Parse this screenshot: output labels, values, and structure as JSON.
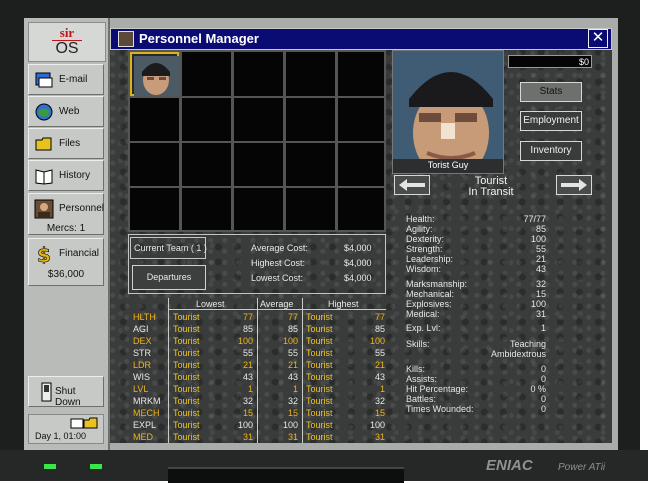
{
  "window": {
    "title": "Personnel Manager",
    "close": "✕"
  },
  "logo": {
    "top": "sir",
    "bottom": "OS"
  },
  "sidebar": {
    "email": "E-mail",
    "web": "Web",
    "files": "Files",
    "history": "History",
    "personnel": "Personnel",
    "mercs": "Mercs: 1",
    "financial": "Financial",
    "balance": "$36,000",
    "shutdown": "Shut Down",
    "datetime": "Day 1, 01:00"
  },
  "team": {
    "current": "Current Team ( 1 )",
    "departures": "Departures",
    "avg_label": "Average Cost:",
    "avg_value": "$4,000",
    "high_label": "Highest Cost:",
    "high_value": "$4,000",
    "low_label": "Lowest Cost:",
    "low_value": "$4,000"
  },
  "table": {
    "headers": [
      "Lowest",
      "Average",
      "Highest"
    ],
    "rows": [
      {
        "attr": "HLTH",
        "lowname": "Tourist",
        "low": "77",
        "avg": "77",
        "highname": "Tourist",
        "high": "77"
      },
      {
        "attr": "AGI",
        "lowname": "Tourist",
        "low": "85",
        "avg": "85",
        "highname": "Tourist",
        "high": "85"
      },
      {
        "attr": "DEX",
        "lowname": "Tourist",
        "low": "100",
        "avg": "100",
        "highname": "Tourist",
        "high": "100"
      },
      {
        "attr": "STR",
        "lowname": "Tourist",
        "low": "55",
        "avg": "55",
        "highname": "Tourist",
        "high": "55"
      },
      {
        "attr": "LDR",
        "lowname": "Tourist",
        "low": "21",
        "avg": "21",
        "highname": "Tourist",
        "high": "21"
      },
      {
        "attr": "WIS",
        "lowname": "Tourist",
        "low": "43",
        "avg": "43",
        "highname": "Tourist",
        "high": "43"
      },
      {
        "attr": "LVL",
        "lowname": "Tourist",
        "low": "1",
        "avg": "1",
        "highname": "Tourist",
        "high": "1"
      },
      {
        "attr": "MRKM",
        "lowname": "Tourist",
        "low": "32",
        "avg": "32",
        "highname": "Tourist",
        "high": "32"
      },
      {
        "attr": "MECH",
        "lowname": "Tourist",
        "low": "15",
        "avg": "15",
        "highname": "Tourist",
        "high": "15"
      },
      {
        "attr": "EXPL",
        "lowname": "Tourist",
        "low": "100",
        "avg": "100",
        "highname": "Tourist",
        "high": "100"
      },
      {
        "attr": "MED",
        "lowname": "Tourist",
        "low": "31",
        "avg": "31",
        "highname": "Tourist",
        "high": "31"
      }
    ]
  },
  "merc": {
    "portrait_name": "Torist Guy",
    "name": "Tourist",
    "status": "In Transit",
    "money": "$0",
    "buttons": [
      "Stats",
      "Employment",
      "Inventory"
    ],
    "attrs1": [
      {
        "label": "Health:",
        "value": "77/77"
      },
      {
        "label": "Agility:",
        "value": "85"
      },
      {
        "label": "Dexterity:",
        "value": "100"
      },
      {
        "label": "Strength:",
        "value": "55"
      },
      {
        "label": "Leadership:",
        "value": "21"
      },
      {
        "label": "Wisdom:",
        "value": "43"
      }
    ],
    "attrs2": [
      {
        "label": "Marksmanship:",
        "value": "32"
      },
      {
        "label": "Mechanical:",
        "value": "15"
      },
      {
        "label": "Explosives:",
        "value": "100"
      },
      {
        "label": "Medical:",
        "value": "31"
      }
    ],
    "exp_label": "Exp. Lvl:",
    "exp_value": "1",
    "skills_label": "Skills:",
    "skills": [
      "Teaching",
      "Ambidextrous"
    ],
    "record": [
      {
        "label": "Kills:",
        "value": "0"
      },
      {
        "label": "Assists:",
        "value": "0"
      },
      {
        "label": "Hit Percentage:",
        "value": "0 %"
      },
      {
        "label": "Battles:",
        "value": "0"
      },
      {
        "label": "Times Wounded:",
        "value": "0"
      }
    ]
  },
  "brand": {
    "name": "ENIAC",
    "model": "Power ATii"
  },
  "colors": {
    "title_bar": "#0b0b74",
    "highlight_label": "#f0b418",
    "tourist_yellow": "#f0c418"
  }
}
